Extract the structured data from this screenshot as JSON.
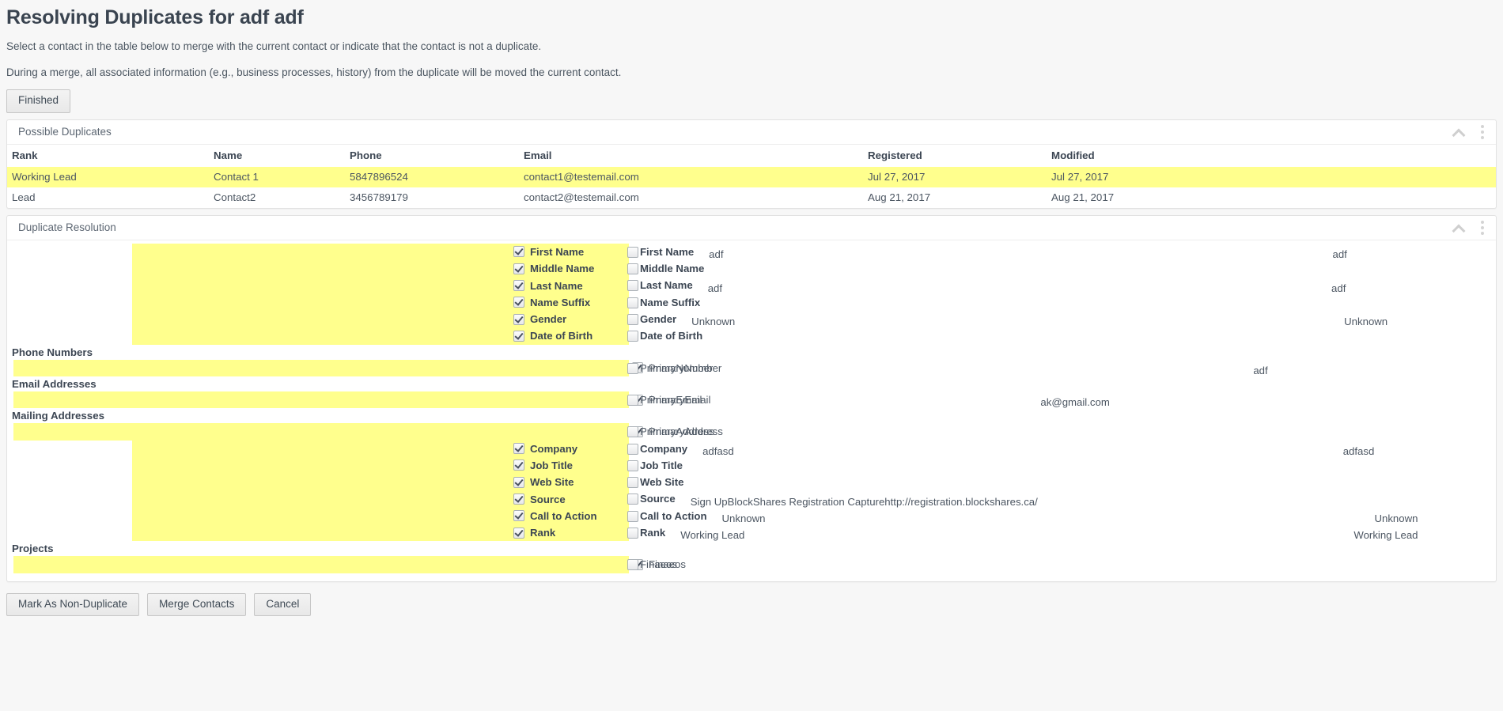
{
  "header": {
    "title": "Resolving Duplicates for adf adf",
    "line1": "Select a contact in the table below to merge with the current contact or indicate that the contact is not a duplicate.",
    "line2": "During a merge, all associated information (e.g., business processes, history) from the duplicate will be moved the current contact.",
    "finished_label": "Finished"
  },
  "duplicates_panel": {
    "title": "Possible Duplicates",
    "collapse_icon": "chevron-up-icon",
    "menu_icon": "kebab-menu-icon",
    "columns": [
      "Rank",
      "Name",
      "Phone",
      "Email",
      "Registered",
      "Modified"
    ],
    "rows": [
      {
        "selected": true,
        "cells": [
          "Working Lead",
          "Contact 1",
          "5847896524",
          "contact1@testemail.com",
          "Jul 27, 2017",
          "Jul 27, 2017"
        ]
      },
      {
        "selected": false,
        "cells": [
          "Lead",
          "Contact2",
          "3456789179",
          "contact2@testemail.com",
          "Aug 21, 2017",
          "Aug 21, 2017"
        ]
      }
    ]
  },
  "resolution_panel": {
    "title": "Duplicate Resolution",
    "collapse_icon": "chevron-up-icon",
    "menu_icon": "kebab-menu-icon",
    "fields": [
      {
        "kind": "field",
        "label": "First Name",
        "left_checked": true,
        "right_checked": false,
        "left_value": "adf",
        "right_value": "adf"
      },
      {
        "kind": "field",
        "label": "Middle Name",
        "left_checked": true,
        "right_checked": false,
        "left_value": "",
        "right_value": ""
      },
      {
        "kind": "field",
        "label": "Last Name",
        "left_checked": true,
        "right_checked": false,
        "left_value": "adf",
        "right_value": "adf"
      },
      {
        "kind": "field",
        "label": "Name Suffix",
        "left_checked": true,
        "right_checked": false,
        "left_value": "",
        "right_value": ""
      },
      {
        "kind": "field",
        "label": "Gender",
        "left_checked": true,
        "right_checked": false,
        "left_value": "Unknown",
        "right_value": "Unknown"
      },
      {
        "kind": "field",
        "label": "Date of Birth",
        "left_checked": true,
        "right_checked": false,
        "left_value": "",
        "right_value": ""
      },
      {
        "kind": "section",
        "label": "Phone Numbers"
      },
      {
        "kind": "field",
        "label": "PrimaryNumber",
        "plain": true,
        "left_checked": true,
        "right_checked": false,
        "left_value": "adf",
        "right_value": "adf",
        "wide": true
      },
      {
        "kind": "section",
        "label": "Email Addresses"
      },
      {
        "kind": "field",
        "label": "PrimaryEmail",
        "plain": true,
        "left_checked": true,
        "right_checked": false,
        "left_value": "ak@gmail.com",
        "right_value": "ak@gmail.com",
        "wide": true
      },
      {
        "kind": "section",
        "label": "Mailing Addresses"
      },
      {
        "kind": "field",
        "label": "PrimaryAddress",
        "plain": true,
        "left_checked": true,
        "right_checked": false,
        "left_value": "",
        "right_value": "",
        "wide": true
      },
      {
        "kind": "field",
        "label": "Company",
        "left_checked": true,
        "right_checked": false,
        "left_value": "adfasd",
        "right_value": "adfasd"
      },
      {
        "kind": "field",
        "label": "Job Title",
        "left_checked": true,
        "right_checked": false,
        "left_value": "",
        "right_value": ""
      },
      {
        "kind": "field",
        "label": "Web Site",
        "left_checked": true,
        "right_checked": false,
        "left_value": "",
        "right_value": ""
      },
      {
        "kind": "field",
        "label": "Source",
        "left_checked": true,
        "right_checked": false,
        "left_value": "Sign UpBlockShares Registration Capturehttp://registration.blockshares.ca/",
        "right_value": "Sign UpBlockShares Registration Capturehttp://registration.blockshares.ca/"
      },
      {
        "kind": "field",
        "label": "Call to Action",
        "left_checked": true,
        "right_checked": false,
        "left_value": "Unknown",
        "right_value": "Unknown"
      },
      {
        "kind": "field",
        "label": "Rank",
        "left_checked": true,
        "right_checked": false,
        "left_value": "Working Lead",
        "right_value": "Working Lead"
      },
      {
        "kind": "section",
        "label": "Projects"
      },
      {
        "kind": "field",
        "label": "Finaeos",
        "plain": true,
        "left_checked": true,
        "right_checked": false,
        "left_value": "",
        "right_value": "",
        "wide": true
      }
    ]
  },
  "footer": {
    "mark_non_duplicate_label": "Mark As Non-Duplicate",
    "merge_contacts_label": "Merge Contacts",
    "cancel_label": "Cancel"
  },
  "colors": {
    "highlight": "#ffff8d",
    "text": "#404a56",
    "panel_border": "#e2e2e2"
  }
}
